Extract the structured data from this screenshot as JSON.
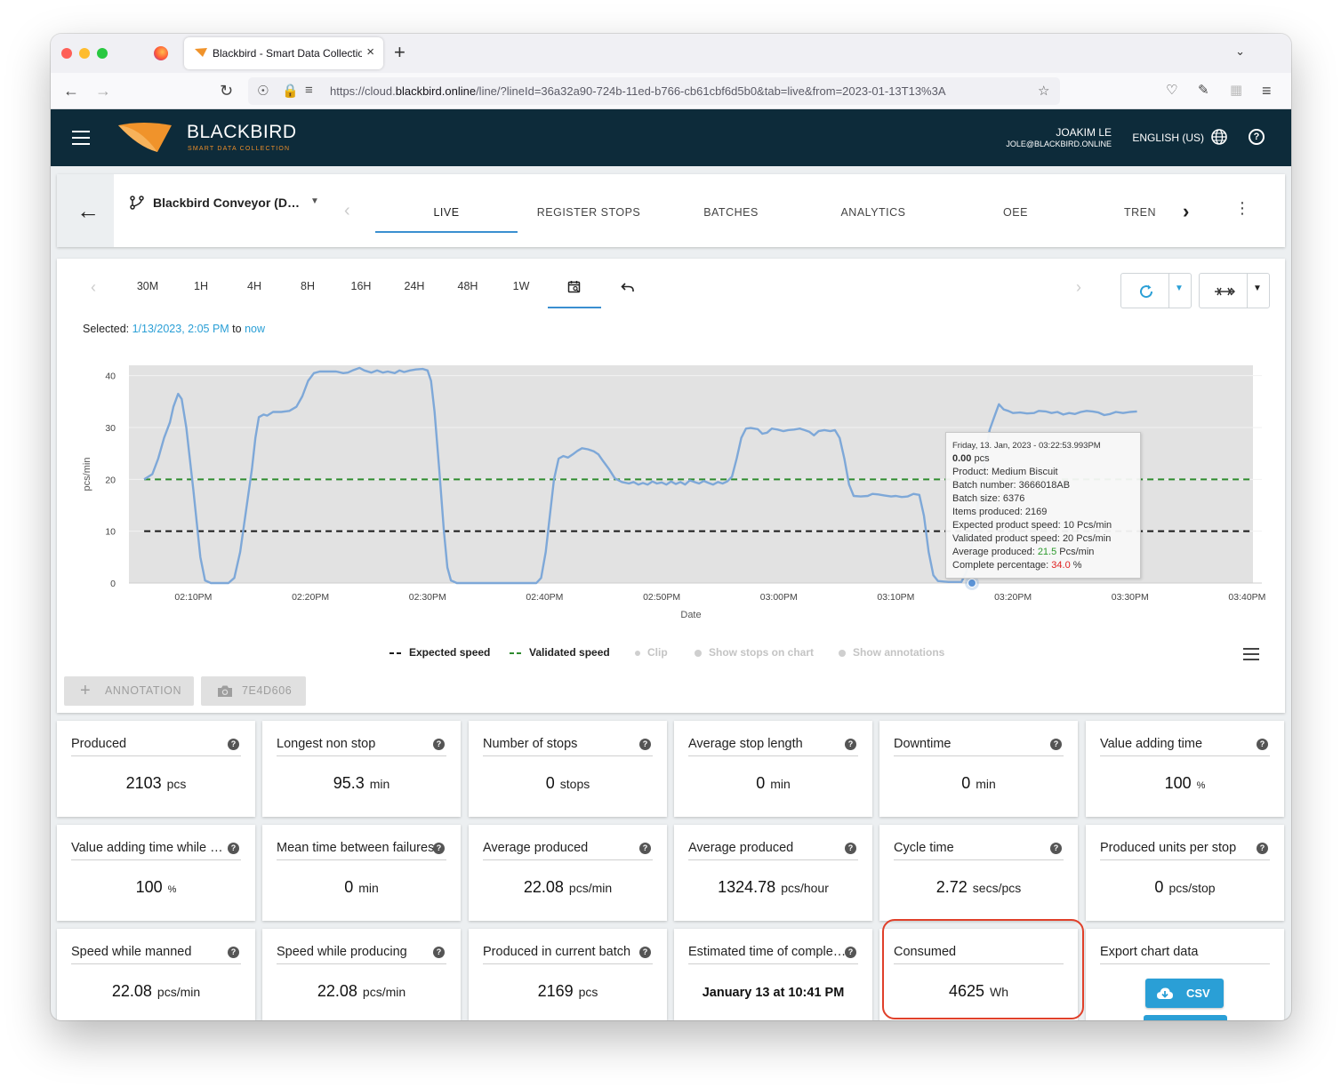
{
  "browser": {
    "tab_title": "Blackbird - Smart Data Collection",
    "tab_close": "×",
    "new_tab": "+",
    "url_scheme": "https://cloud.",
    "url_host": "blackbird.online",
    "url_path": "/line/?lineId=36a32a90-724b-11ed-b766-cb61cbf6d5b0&tab=live&from=2023-01-13T13%3A"
  },
  "header": {
    "brand": "BLACKBIRD",
    "tagline": "SMART DATA COLLECTION",
    "user_name": "JOAKIM LE",
    "user_email": "JOLE@BLACKBIRD.ONLINE",
    "language": "ENGLISH (US)",
    "help": "?"
  },
  "line": {
    "name": "Blackbird Conveyor (Demo)"
  },
  "tabs": [
    {
      "label": "LIVE"
    },
    {
      "label": "REGISTER STOPS"
    },
    {
      "label": "BATCHES"
    },
    {
      "label": "ANALYTICS"
    },
    {
      "label": "OEE"
    },
    {
      "label": "TREN"
    }
  ],
  "range_buttons": [
    "30M",
    "1H",
    "4H",
    "8H",
    "16H",
    "24H",
    "48H",
    "1W"
  ],
  "selection": {
    "prefix": "Selected: ",
    "from": "1/13/2023, 2:05 PM",
    "connector": " to ",
    "to": "now"
  },
  "chart_data": {
    "type": "line",
    "xlabel": "Date",
    "ylabel": "pcs/min",
    "ylim": [
      0,
      42
    ],
    "y_ticks": [
      0,
      10,
      20,
      30,
      40
    ],
    "x_ticks": [
      "02:10PM",
      "02:20PM",
      "02:30PM",
      "02:40PM",
      "02:50PM",
      "03:00PM",
      "03:10PM",
      "03:20PM",
      "03:30PM",
      "03:40PM"
    ],
    "x_range_minutes": [
      -5.5,
      90.5
    ],
    "grid": true,
    "series": [
      {
        "name": "",
        "color": "#7ea8d8",
        "points": [
          [
            -4.2,
            20
          ],
          [
            -3.5,
            21
          ],
          [
            -3,
            24
          ],
          [
            -2.5,
            28
          ],
          [
            -2,
            31
          ],
          [
            -1.7,
            34
          ],
          [
            -1.3,
            36.5
          ],
          [
            -1,
            35.5
          ],
          [
            -0.6,
            30
          ],
          [
            0,
            18
          ],
          [
            0.6,
            5
          ],
          [
            1,
            0.5
          ],
          [
            1.5,
            0
          ],
          [
            2.5,
            0
          ],
          [
            3,
            0
          ],
          [
            3.5,
            1
          ],
          [
            4,
            6
          ],
          [
            4.5,
            14
          ],
          [
            5,
            22
          ],
          [
            5.3,
            28
          ],
          [
            5.6,
            32
          ],
          [
            6,
            32.5
          ],
          [
            6.3,
            32.3
          ],
          [
            6.8,
            33
          ],
          [
            7.5,
            33
          ],
          [
            8.2,
            33.2
          ],
          [
            8.8,
            34
          ],
          [
            9.3,
            36
          ],
          [
            9.8,
            39
          ],
          [
            10.3,
            40.5
          ],
          [
            10.8,
            40.8
          ],
          [
            11.5,
            40.8
          ],
          [
            12.2,
            40.8
          ],
          [
            12.8,
            40.5
          ],
          [
            13.2,
            40.6
          ],
          [
            13.6,
            41
          ],
          [
            14.2,
            41.5
          ],
          [
            14.6,
            41
          ],
          [
            15.2,
            40.6
          ],
          [
            15.7,
            41
          ],
          [
            16.2,
            40.6
          ],
          [
            16.6,
            40.8
          ],
          [
            17.2,
            40.5
          ],
          [
            17.6,
            41
          ],
          [
            18,
            40.7
          ],
          [
            18.5,
            41
          ],
          [
            19,
            41.2
          ],
          [
            19.6,
            41.3
          ],
          [
            20,
            41
          ],
          [
            20.3,
            39
          ],
          [
            20.6,
            33
          ],
          [
            21,
            22
          ],
          [
            21.4,
            10
          ],
          [
            21.7,
            3
          ],
          [
            22,
            0.5
          ],
          [
            22.5,
            0
          ],
          [
            24,
            0
          ],
          [
            27,
            0
          ],
          [
            29.3,
            0
          ],
          [
            29.7,
            1
          ],
          [
            30.1,
            6
          ],
          [
            30.5,
            14
          ],
          [
            30.8,
            20
          ],
          [
            31.2,
            24
          ],
          [
            31.6,
            24.5
          ],
          [
            32,
            24.2
          ],
          [
            32.4,
            24.8
          ],
          [
            32.8,
            25.5
          ],
          [
            33.2,
            26
          ],
          [
            33.7,
            25.8
          ],
          [
            34.2,
            25.4
          ],
          [
            34.6,
            24.8
          ],
          [
            35,
            23.5
          ],
          [
            35.5,
            22
          ],
          [
            36,
            20.2
          ],
          [
            36.6,
            19.5
          ],
          [
            37.2,
            19.2
          ],
          [
            37.6,
            19.5
          ],
          [
            38,
            19
          ],
          [
            38.4,
            19.3
          ],
          [
            38.8,
            19
          ],
          [
            39.2,
            19.6
          ],
          [
            39.6,
            19.2
          ],
          [
            40,
            19.4
          ],
          [
            40.4,
            19
          ],
          [
            40.8,
            19.6
          ],
          [
            41.2,
            19.1
          ],
          [
            41.6,
            19.5
          ],
          [
            42,
            19
          ],
          [
            42.4,
            19.8
          ],
          [
            42.8,
            19.5
          ],
          [
            43.2,
            19.2
          ],
          [
            43.6,
            19.7
          ],
          [
            44,
            19.3
          ],
          [
            44.4,
            19
          ],
          [
            44.8,
            19.5
          ],
          [
            45.2,
            19.2
          ],
          [
            45.6,
            19.6
          ],
          [
            46,
            20.5
          ],
          [
            46.4,
            24
          ],
          [
            46.8,
            28
          ],
          [
            47.2,
            29.8
          ],
          [
            47.6,
            29.9
          ],
          [
            48.2,
            29.7
          ],
          [
            48.6,
            28.8
          ],
          [
            49,
            29
          ],
          [
            49.4,
            29.8
          ],
          [
            49.9,
            29.6
          ],
          [
            50.4,
            29.3
          ],
          [
            50.8,
            29.5
          ],
          [
            51.3,
            29.6
          ],
          [
            51.8,
            29.8
          ],
          [
            52.2,
            29.5
          ],
          [
            52.6,
            29.2
          ],
          [
            53,
            28.5
          ],
          [
            53.4,
            29.3
          ],
          [
            53.9,
            29.5
          ],
          [
            54.4,
            29.3
          ],
          [
            54.8,
            29.5
          ],
          [
            55.2,
            28
          ],
          [
            55.6,
            24
          ],
          [
            56,
            19
          ],
          [
            56.4,
            16.8
          ],
          [
            57,
            16.7
          ],
          [
            57.6,
            16.8
          ],
          [
            58,
            17.2
          ],
          [
            58.5,
            17.1
          ],
          [
            59,
            16.9
          ],
          [
            59.6,
            16.7
          ],
          [
            60,
            16.8
          ],
          [
            60.5,
            16.6
          ],
          [
            61,
            16.7
          ],
          [
            61.5,
            17.2
          ],
          [
            62,
            17
          ],
          [
            62.4,
            13
          ],
          [
            62.8,
            6
          ],
          [
            63.2,
            1.5
          ],
          [
            63.6,
            0.4
          ],
          [
            64.5,
            0.2
          ],
          [
            65.6,
            0.2
          ],
          [
            66,
            2
          ],
          [
            66.4,
            6
          ],
          [
            66.8,
            12
          ],
          [
            67.2,
            18
          ],
          [
            67.6,
            24
          ],
          [
            68,
            29.5
          ],
          [
            68.4,
            32
          ],
          [
            68.8,
            34.5
          ],
          [
            69.2,
            33.5
          ],
          [
            69.6,
            33.2
          ],
          [
            70,
            32.8
          ],
          [
            70.6,
            32.9
          ],
          [
            71.2,
            32.7
          ],
          [
            71.8,
            32.8
          ],
          [
            72.2,
            33.2
          ],
          [
            72.8,
            33.1
          ],
          [
            73.3,
            32.8
          ],
          [
            73.8,
            33
          ],
          [
            74.3,
            32.5
          ],
          [
            74.8,
            32.8
          ],
          [
            75.3,
            32.6
          ],
          [
            75.8,
            33
          ],
          [
            76.3,
            33.2
          ],
          [
            76.8,
            33.1
          ],
          [
            77.3,
            32.9
          ],
          [
            77.8,
            32.4
          ],
          [
            78.3,
            32.6
          ],
          [
            78.8,
            33
          ],
          [
            79.4,
            32.8
          ],
          [
            80,
            33
          ],
          [
            80.6,
            33.1
          ]
        ]
      },
      {
        "name": "Expected speed",
        "color": "#1a1a1a",
        "dash": true,
        "constant": 10
      },
      {
        "name": "Validated speed",
        "color": "#2e8b2e",
        "dash": true,
        "constant": 20
      }
    ],
    "hover_point": [
      66.5,
      0
    ],
    "tooltip": {
      "time": "Friday, 13. Jan, 2023 - 03:22:53.993PM",
      "value": "0.00",
      "value_unit": " pcs",
      "product": "Product: Medium Biscuit",
      "batch_number": "Batch number: 3666018AB",
      "batch_size": "Batch size: 6376",
      "items_produced": "Items produced: 2169",
      "expected_speed": "Expected product speed: 10 Pcs/min",
      "validated_speed": "Validated product speed: 20 Pcs/min",
      "avg_label": "Average produced: ",
      "avg_value": "21.5",
      "avg_unit": " Pcs/min",
      "pct_label": "Complete percentage: ",
      "pct_value": "34.0",
      "pct_unit": " %"
    },
    "legend": [
      {
        "label": "Expected speed",
        "active": true
      },
      {
        "label": "Validated speed",
        "active": true
      },
      {
        "label": "Clip",
        "active": false
      },
      {
        "label": "Show stops on chart",
        "active": false
      },
      {
        "label": "Show annotations",
        "active": false
      }
    ]
  },
  "actions": {
    "annotation": "ANNOTATION",
    "snapshot": "7E4D606"
  },
  "kpis": [
    {
      "title": "Produced",
      "value": "2103",
      "unit": "pcs"
    },
    {
      "title": "Longest non stop",
      "value": "95.3",
      "unit": "min"
    },
    {
      "title": "Number of stops",
      "value": "0",
      "unit": "stops"
    },
    {
      "title": "Average stop length",
      "value": "0",
      "unit": "min"
    },
    {
      "title": "Downtime",
      "value": "0",
      "unit": "min"
    },
    {
      "title": "Value adding time",
      "value": "100",
      "unit": "%"
    },
    {
      "title": "Value adding time while manned",
      "value": "100",
      "unit": "%"
    },
    {
      "title": "Mean time between failures",
      "value": "0",
      "unit": "min"
    },
    {
      "title": "Average produced",
      "value": "22.08",
      "unit": "pcs/min"
    },
    {
      "title": "Average produced",
      "value": "1324.78",
      "unit": "pcs/hour"
    },
    {
      "title": "Cycle time",
      "value": "2.72",
      "unit": "secs/pcs"
    },
    {
      "title": "Produced units per stop",
      "value": "0",
      "unit": "pcs/stop"
    },
    {
      "title": "Speed while manned",
      "value": "22.08",
      "unit": "pcs/min"
    },
    {
      "title": "Speed while producing",
      "value": "22.08",
      "unit": "pcs/min"
    },
    {
      "title": "Produced in current batch",
      "value": "2169",
      "unit": "pcs"
    },
    {
      "title": "Estimated time of completion",
      "value": "January 13 at 10:41 PM",
      "unit": ""
    },
    {
      "title": "Consumed",
      "value": "4625",
      "unit": "Wh"
    }
  ],
  "export": {
    "title": "Export chart data",
    "csv_label": "CSV"
  },
  "colors": {
    "header_bg": "#0d2b3a",
    "accent": "#2a9fd6",
    "logo_orange": "#f0932b",
    "highlight": "#e0402a"
  }
}
